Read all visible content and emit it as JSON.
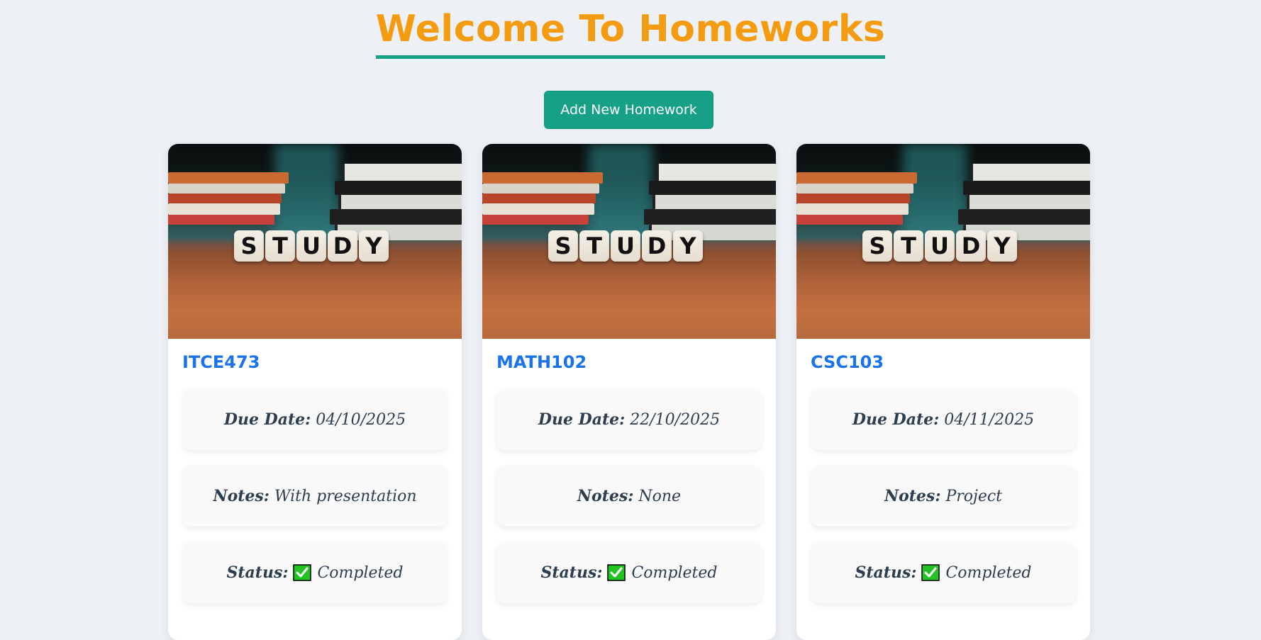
{
  "header": {
    "title": "Welcome To Homeworks",
    "title_color": "#f39c12",
    "underline_color": "#16a085"
  },
  "actions": {
    "add_label": "Add New Homework",
    "button_color": "#16a085"
  },
  "image": {
    "dice_letters": [
      "S",
      "T",
      "U",
      "D",
      "Y"
    ]
  },
  "labels": {
    "due_date": "Due Date:",
    "notes": "Notes:",
    "status": "Status:"
  },
  "homeworks": [
    {
      "course": "ITCE473",
      "due_date": "04/10/2025",
      "notes": "With presentation",
      "status": "Completed",
      "status_icon": "check-mark-icon"
    },
    {
      "course": "MATH102",
      "due_date": "22/10/2025",
      "notes": "None",
      "status": "Completed",
      "status_icon": "check-mark-icon"
    },
    {
      "course": "CSC103",
      "due_date": "04/11/2025",
      "notes": "Project",
      "status": "Completed",
      "status_icon": "check-mark-icon"
    }
  ],
  "colors": {
    "background": "#edf0f5",
    "course_title": "#1a73e8",
    "text": "#2c3e50",
    "check_green": "#22c322"
  }
}
